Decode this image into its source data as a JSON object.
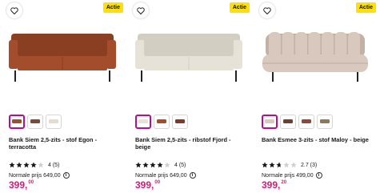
{
  "products": [
    {
      "badge": "Actie",
      "title": "Bank Siem 2,5-zits - stof Egon - terracotta",
      "rating_value": 4,
      "rating_text": "4 (5)",
      "normal_price_label": "Normale prijs 649,00",
      "price_main": "399,",
      "price_cents": "00",
      "sofa_color": "#a34d2c",
      "sofa_shade": "#8a3e22",
      "swatches": [
        "#a34d2c",
        "#7a4a3a",
        "#e3dccf"
      ],
      "active_swatch": 0
    },
    {
      "badge": "Actie",
      "title": "Bank Siem 2,5-zits - ribstof Fjord - beige",
      "rating_value": 4,
      "rating_text": "4 (5)",
      "normal_price_label": "Normale prijs 649,00",
      "price_main": "399,",
      "price_cents": "00",
      "sofa_color": "#e6e2d8",
      "sofa_shade": "#d3cec2",
      "swatches": [
        "#e6e2d8",
        "#a34d2c",
        "#7a3a2c"
      ],
      "active_swatch": 0
    },
    {
      "badge": "Actie",
      "title": "Bank Esmee 3-zits - stof Maloy - beige",
      "rating_value": 2.7,
      "rating_text": "2.7 (3)",
      "normal_price_label": "Normale prijs 499,00",
      "price_main": "399,",
      "price_cents": "20",
      "sofa_color": "#d8c8bd",
      "sofa_shade": "#c3b1a5",
      "swatches": [
        "#d8c8bd",
        "#6e4032",
        "#8a4b3c",
        "#8b7a5a"
      ],
      "active_swatch": 0
    }
  ],
  "colors": {
    "accent": "#b0128c",
    "price": "#d6197a",
    "badge_bg": "#ffe000"
  }
}
